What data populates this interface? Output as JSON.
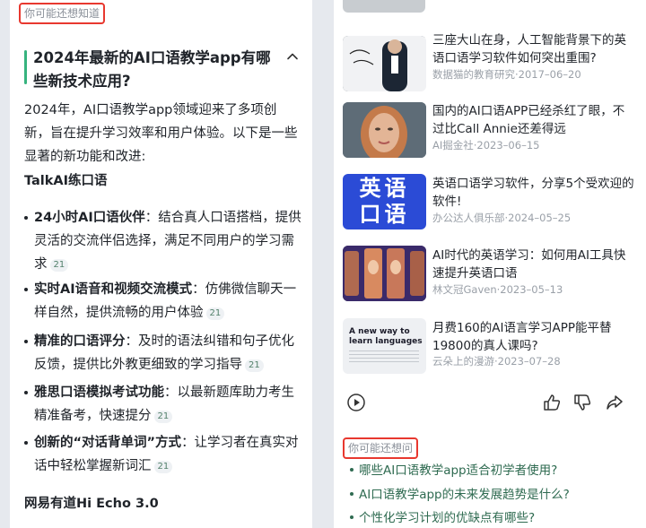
{
  "left": {
    "hint_tag": "你可能还想知道",
    "question_title": "2024年最新的AI口语教学app有哪些新技术应用?",
    "intro": "2024年，AI口语教学app领域迎来了多项创新，旨在提升学习效率和用户体验。以下是一些显著的新功能和改进:",
    "section1_heading": "TalkAI练口语",
    "bullets": [
      {
        "bold": "24小时AI口语伙伴",
        "text": "：结合真人口语搭档，提供灵活的交流伴侣选择，满足不同用户的学习需求",
        "cite": "21"
      },
      {
        "bold": "实时AI语音和视频交流模式",
        "text": "：仿佛微信聊天一样自然，提供流畅的用户体验",
        "cite": "21"
      },
      {
        "bold": "精准的口语评分",
        "text": "：及时的语法纠错和句子优化反馈，提供比外教更细致的学习指导",
        "cite": "21"
      },
      {
        "bold": "雅思口语模拟考试功能",
        "text": "：以最新题库助力考生精准备考，快速提分",
        "cite": "21"
      },
      {
        "bold": "创新的“对话背单词”方式",
        "text": "：让学习者在真实对话中轻松掌握新词汇",
        "cite": "21"
      }
    ],
    "section2_heading": "网易有道Hi Echo 3.0"
  },
  "right": {
    "articles": [
      {
        "title": "三座大山在身，人工智能背景下的英语口语学习软件如何突出重围?",
        "meta": "数据猫的教育研究·2017–06–20",
        "thumb": "speak-english-photo"
      },
      {
        "title": "国内的AI口语APP已经杀红了眼，不过比Call Annie还差得远",
        "meta": "AI掘金社·2023–06–15",
        "thumb": "ai-woman-portrait"
      },
      {
        "title": "英语口语学习软件，分享5个受欢迎的软件!",
        "meta": "办公达人俱乐部·2024–05–25",
        "thumb": "english-speaking-banner",
        "thumb_text": [
          "英语",
          "口语"
        ]
      },
      {
        "title": "AI时代的英语学习：如何用AI工具快速提升英语口语",
        "meta": "林文冠Gaven·2023–05–13",
        "thumb": "ai-avatar-phones"
      },
      {
        "title": "月费160的AI语言学习APP能平替19800的真人课吗?",
        "meta": "云朵上的漫游·2023–07–28",
        "thumb": "new-way-learn-languages",
        "thumb_text": [
          "A new way to",
          "learn languages"
        ]
      }
    ],
    "hint_tag": "你可能还想问",
    "related_questions": [
      "哪些AI口语教学app适合初学者使用?",
      "AI口语教学app的未来发展趋势是什么?",
      "个性化学习计划的优缺点有哪些?"
    ],
    "actions": [
      "play-icon",
      "thumbs-up-icon",
      "thumbs-down-icon",
      "share-icon"
    ]
  }
}
